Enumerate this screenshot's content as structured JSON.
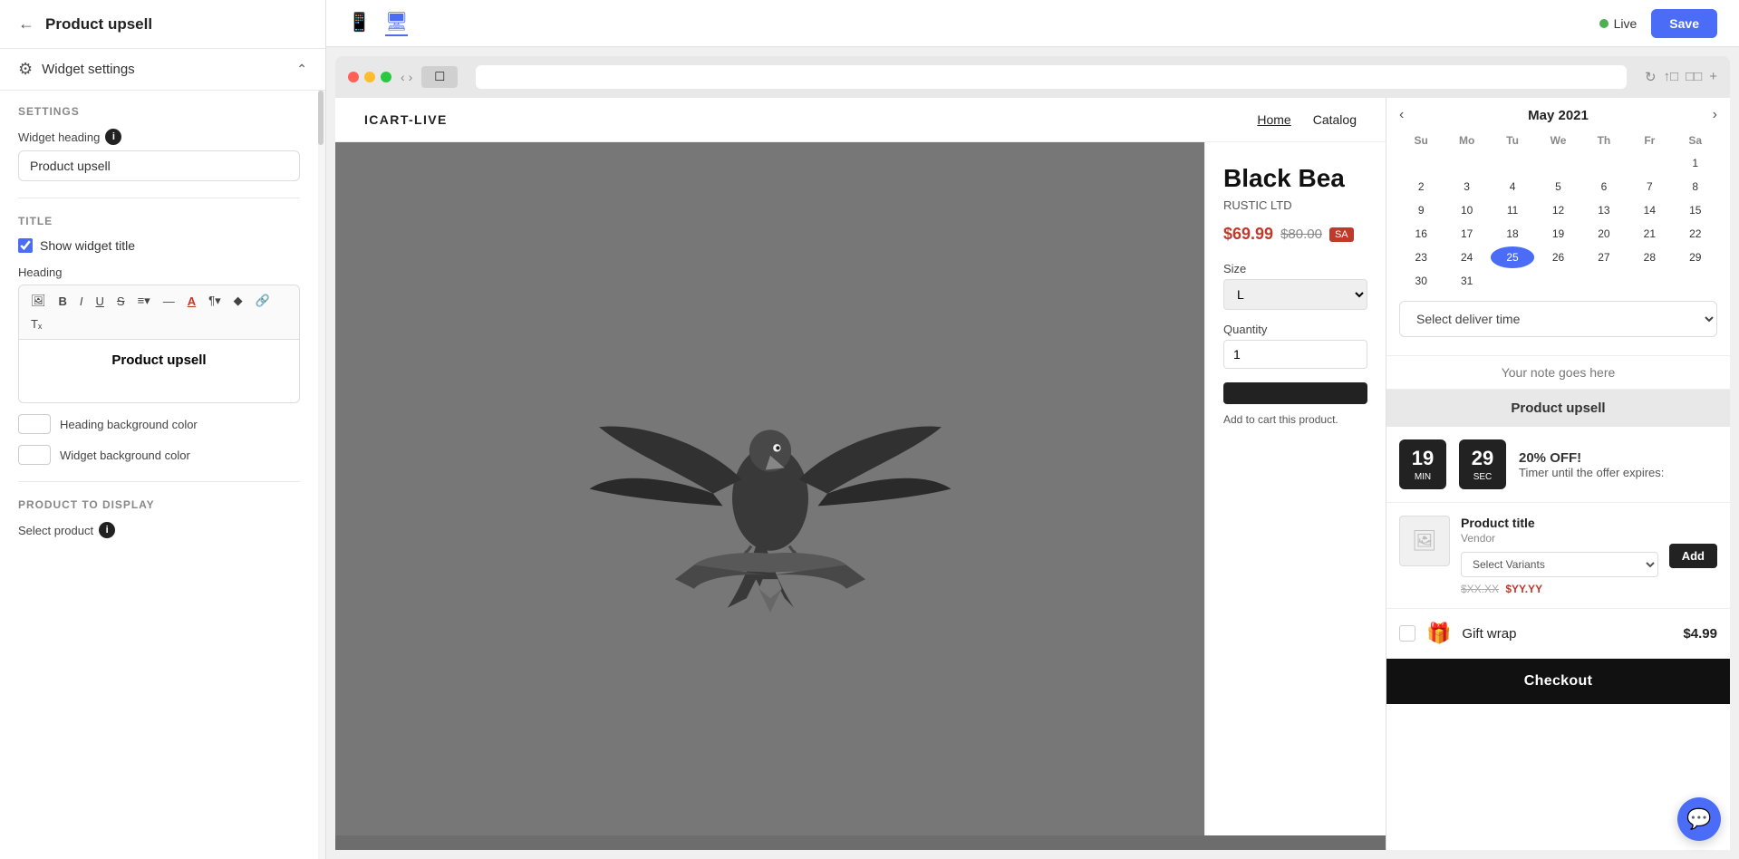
{
  "header": {
    "back_label": "←",
    "title": "Product upsell",
    "live_label": "Live",
    "save_label": "Save"
  },
  "widget_settings": {
    "label": "Widget settings",
    "sections": {
      "settings_title": "SETTINGS",
      "widget_heading_label": "Widget heading",
      "widget_heading_value": "Product upsell",
      "title_section": "TITLE",
      "show_widget_title_label": "Show widget title",
      "heading_label": "Heading",
      "heading_value": "Product upsell",
      "heading_bg_color_label": "Heading background color",
      "widget_bg_color_label": "Widget background color",
      "product_to_display": "PRODUCT TO DISPLAY",
      "select_product_label": "Select product"
    }
  },
  "toolbar": {
    "image_btn": "🖼",
    "bold_btn": "B",
    "italic_btn": "I",
    "underline_btn": "U",
    "strikethrough_btn": "S",
    "align_btn": "≡",
    "hr_btn": "—",
    "font_color_btn": "A",
    "paragraph_btn": "¶",
    "ink_btn": "✦",
    "link_btn": "🔗",
    "text_btn": "T"
  },
  "devices": {
    "mobile_label": "📱",
    "desktop_label": "🖥"
  },
  "store": {
    "logo": "ICART-LIVE",
    "nav_links": [
      "Home",
      "Catalog"
    ],
    "product_title": "Black Bea",
    "vendor": "RUSTIC LTD",
    "price_current": "$69.99",
    "price_original": "$80.00",
    "sale_badge": "SA",
    "size_label": "Size",
    "size_value": "L",
    "quantity_label": "Quantity",
    "quantity_value": "1",
    "add_to_cart_note": "Add to cart this product."
  },
  "calendar": {
    "month": "May 2021",
    "day_headers": [
      "Su",
      "Mo",
      "Tu",
      "We",
      "Th",
      "Fr",
      "Sa"
    ],
    "weeks": [
      [
        "",
        "",
        "",
        "",
        "",
        "",
        "1"
      ],
      [
        "2",
        "3",
        "4",
        "5",
        "6",
        "7",
        "8"
      ],
      [
        "9",
        "10",
        "11",
        "12",
        "13",
        "14",
        "15"
      ],
      [
        "16",
        "17",
        "18",
        "19",
        "20",
        "21",
        "22"
      ],
      [
        "23",
        "24",
        "25",
        "26",
        "27",
        "28",
        "29"
      ],
      [
        "30",
        "31",
        "",
        "",
        "",
        "",
        ""
      ]
    ],
    "today": "25",
    "deliver_time_placeholder": "Select deliver time",
    "note_placeholder": "Your note goes here"
  },
  "upsell_widget": {
    "header": "Product upsell",
    "timer_min": "19",
    "timer_sec": "29",
    "timer_min_label": "Min",
    "timer_sec_label": "Sec",
    "discount_text": "20% OFF!",
    "expires_text": "Timer until the offer expires:",
    "product_title": "Product title",
    "vendor": "Vendor",
    "variant_placeholder": "Select Variants",
    "add_btn": "Add",
    "price_original": "$XX.XX",
    "price_sale": "$YY.YY",
    "gift_label": "Gift wrap",
    "gift_price": "$4.99",
    "checkout_label": "Checkout"
  }
}
